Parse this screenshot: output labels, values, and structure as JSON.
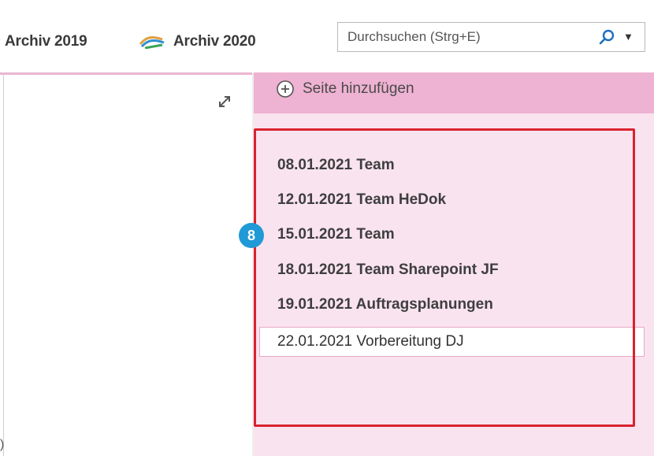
{
  "tabs": [
    {
      "label": "Archiv 2019"
    },
    {
      "label": "Archiv 2020",
      "icon": "notebook-icon"
    }
  ],
  "search": {
    "placeholder": "Durchsuchen (Strg+E)",
    "icon": "search-icon"
  },
  "section": {
    "add_page_label": "Seite hinzufügen"
  },
  "pages": [
    {
      "label": "08.01.2021 Team"
    },
    {
      "label": "12.01.2021 Team HeDok"
    },
    {
      "label": "15.01.2021 Team"
    },
    {
      "label": "18.01.2021 Team Sharepoint JF"
    },
    {
      "label": "19.01.2021 Auftragsplanungen"
    },
    {
      "label": "22.01.2021 Vorbereitung DJ",
      "selected": true
    }
  ],
  "callout": {
    "number": "8"
  },
  "left_pane": {
    "cut_glyph": ")"
  },
  "colors": {
    "section_bar": "#eeb2d2",
    "page_list_bg": "#f9e3ef",
    "highlight": "#d9232e",
    "badge": "#1f9ad6"
  }
}
